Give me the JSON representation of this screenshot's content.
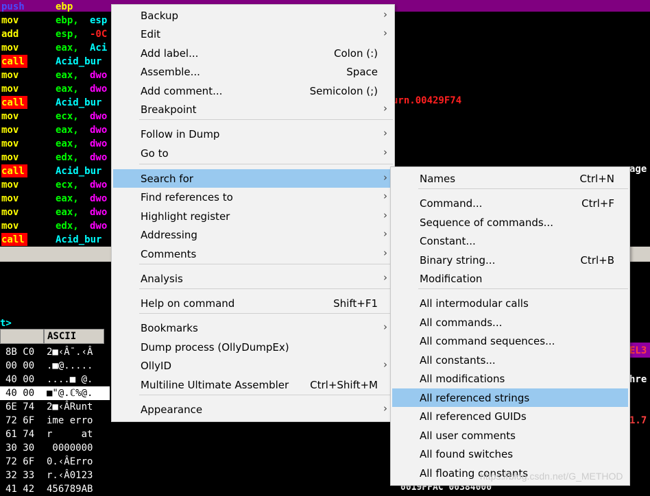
{
  "disasm": {
    "rows": [
      {
        "mn": "push",
        "op": "ebp",
        "op2": ""
      },
      {
        "mn": "mov",
        "op": "ebp,",
        "op2": "esp"
      },
      {
        "mn": "add",
        "op": "esp,",
        "op2": "-0C"
      },
      {
        "mn": "mov",
        "op": "eax,",
        "op2": "Aci"
      },
      {
        "mn": "call",
        "op": "Acid_bur",
        "op2": ""
      },
      {
        "mn": "mov",
        "op": "eax,",
        "op2": "dwo"
      },
      {
        "mn": "mov",
        "op": "eax,",
        "op2": "dwo"
      },
      {
        "mn": "call",
        "op": "Acid_bur",
        "op2": ""
      },
      {
        "mn": "mov",
        "op": "ecx,",
        "op2": "dwo"
      },
      {
        "mn": "mov",
        "op": "eax,",
        "op2": "dwo"
      },
      {
        "mn": "mov",
        "op": "eax,",
        "op2": "dwo"
      },
      {
        "mn": "mov",
        "op": "edx,",
        "op2": "dwo"
      },
      {
        "mn": "call",
        "op": "Acid_bur",
        "op2": ""
      },
      {
        "mn": "mov",
        "op": "ecx,",
        "op2": "dwo"
      },
      {
        "mn": "mov",
        "op": "eax,",
        "op2": "dwo"
      },
      {
        "mn": "mov",
        "op": "eax,",
        "op2": "dwo"
      },
      {
        "mn": "mov",
        "op": "edx,",
        "op2": "dwo"
      },
      {
        "mn": "call",
        "op": "Acid_bur",
        "op2": ""
      }
    ],
    "right_text_1": "urn.00429F74",
    "right_text_2": "age"
  },
  "prompt": "t>",
  "dump": {
    "ascii_header": "ASCII",
    "rows": [
      {
        "hex": "8B C0",
        "ascii": "2■‹Â¯.‹Â"
      },
      {
        "hex": "00 00",
        "ascii": ".■@....."
      },
      {
        "hex": "40 00",
        "ascii": "....■ @."
      },
      {
        "hex": "40 00",
        "ascii": "■\"@.ℂ%@."
      },
      {
        "hex": "6E 74",
        "ascii": "2■‹ÂRunt"
      },
      {
        "hex": "72 6F",
        "ascii": "ime erro"
      },
      {
        "hex": "61 74",
        "ascii": "r     at"
      },
      {
        "hex": "30 30",
        "ascii": " 0000000"
      },
      {
        "hex": "72 6F",
        "ascii": "0.‹ÂErro"
      },
      {
        "hex": "32 33",
        "ascii": "r.‹Â0123"
      },
      {
        "hex": "41 42",
        "ascii": "456789AB"
      }
    ]
  },
  "right_pane": {
    "t1": "EL3",
    "t2": "hre",
    "t3": "1.7",
    "t4": "0019FFAC 00384000"
  },
  "main_menu": {
    "items": [
      {
        "label": "Backup",
        "shortcut": "",
        "submenu": true
      },
      {
        "label": "Edit",
        "shortcut": "",
        "submenu": true
      },
      {
        "label": "Add label...",
        "shortcut": "Colon (:)",
        "submenu": false
      },
      {
        "label": "Assemble...",
        "shortcut": "Space",
        "submenu": false
      },
      {
        "label": "Add comment...",
        "shortcut": "Semicolon (;)",
        "submenu": false
      },
      {
        "label": "Breakpoint",
        "shortcut": "",
        "submenu": true
      },
      {
        "label": "Follow in Dump",
        "shortcut": "",
        "submenu": true
      },
      {
        "label": "Go to",
        "shortcut": "",
        "submenu": true
      },
      {
        "label": "Search for",
        "shortcut": "",
        "submenu": true
      },
      {
        "label": "Find references to",
        "shortcut": "",
        "submenu": true
      },
      {
        "label": "Highlight register",
        "shortcut": "",
        "submenu": true
      },
      {
        "label": "Addressing",
        "shortcut": "",
        "submenu": true
      },
      {
        "label": "Comments",
        "shortcut": "",
        "submenu": true
      },
      {
        "label": "Analysis",
        "shortcut": "",
        "submenu": true
      },
      {
        "label": "Help on command",
        "shortcut": "Shift+F1",
        "submenu": false
      },
      {
        "label": "Bookmarks",
        "shortcut": "",
        "submenu": true
      },
      {
        "label": "Dump process (OllyDumpEx)",
        "shortcut": "",
        "submenu": false
      },
      {
        "label": "OllyID",
        "shortcut": "",
        "submenu": true
      },
      {
        "label": "Multiline Ultimate Assembler",
        "shortcut": "Ctrl+Shift+M",
        "submenu": false
      },
      {
        "label": "Appearance",
        "shortcut": "",
        "submenu": true
      }
    ]
  },
  "search_menu": {
    "items": [
      {
        "label": "Names",
        "shortcut": "Ctrl+N"
      },
      {
        "label": "Command...",
        "shortcut": "Ctrl+F"
      },
      {
        "label": "Sequence of commands...",
        "shortcut": ""
      },
      {
        "label": "Constant...",
        "shortcut": ""
      },
      {
        "label": "Binary string...",
        "shortcut": "Ctrl+B"
      },
      {
        "label": "Modification",
        "shortcut": ""
      },
      {
        "label": "All intermodular calls",
        "shortcut": ""
      },
      {
        "label": "All commands...",
        "shortcut": ""
      },
      {
        "label": "All command sequences...",
        "shortcut": ""
      },
      {
        "label": "All constants...",
        "shortcut": ""
      },
      {
        "label": "All modifications",
        "shortcut": ""
      },
      {
        "label": "All referenced strings",
        "shortcut": ""
      },
      {
        "label": "All referenced GUIDs",
        "shortcut": ""
      },
      {
        "label": "All user comments",
        "shortcut": ""
      },
      {
        "label": "All found switches",
        "shortcut": ""
      },
      {
        "label": "All floating constants",
        "shortcut": ""
      }
    ]
  },
  "watermark": "https://blog.csdn.net/G_METHOD",
  "colors": {
    "menu_highlight": "#99c9ef",
    "call_bg": "#ff0000",
    "titlebar": "#800080"
  }
}
